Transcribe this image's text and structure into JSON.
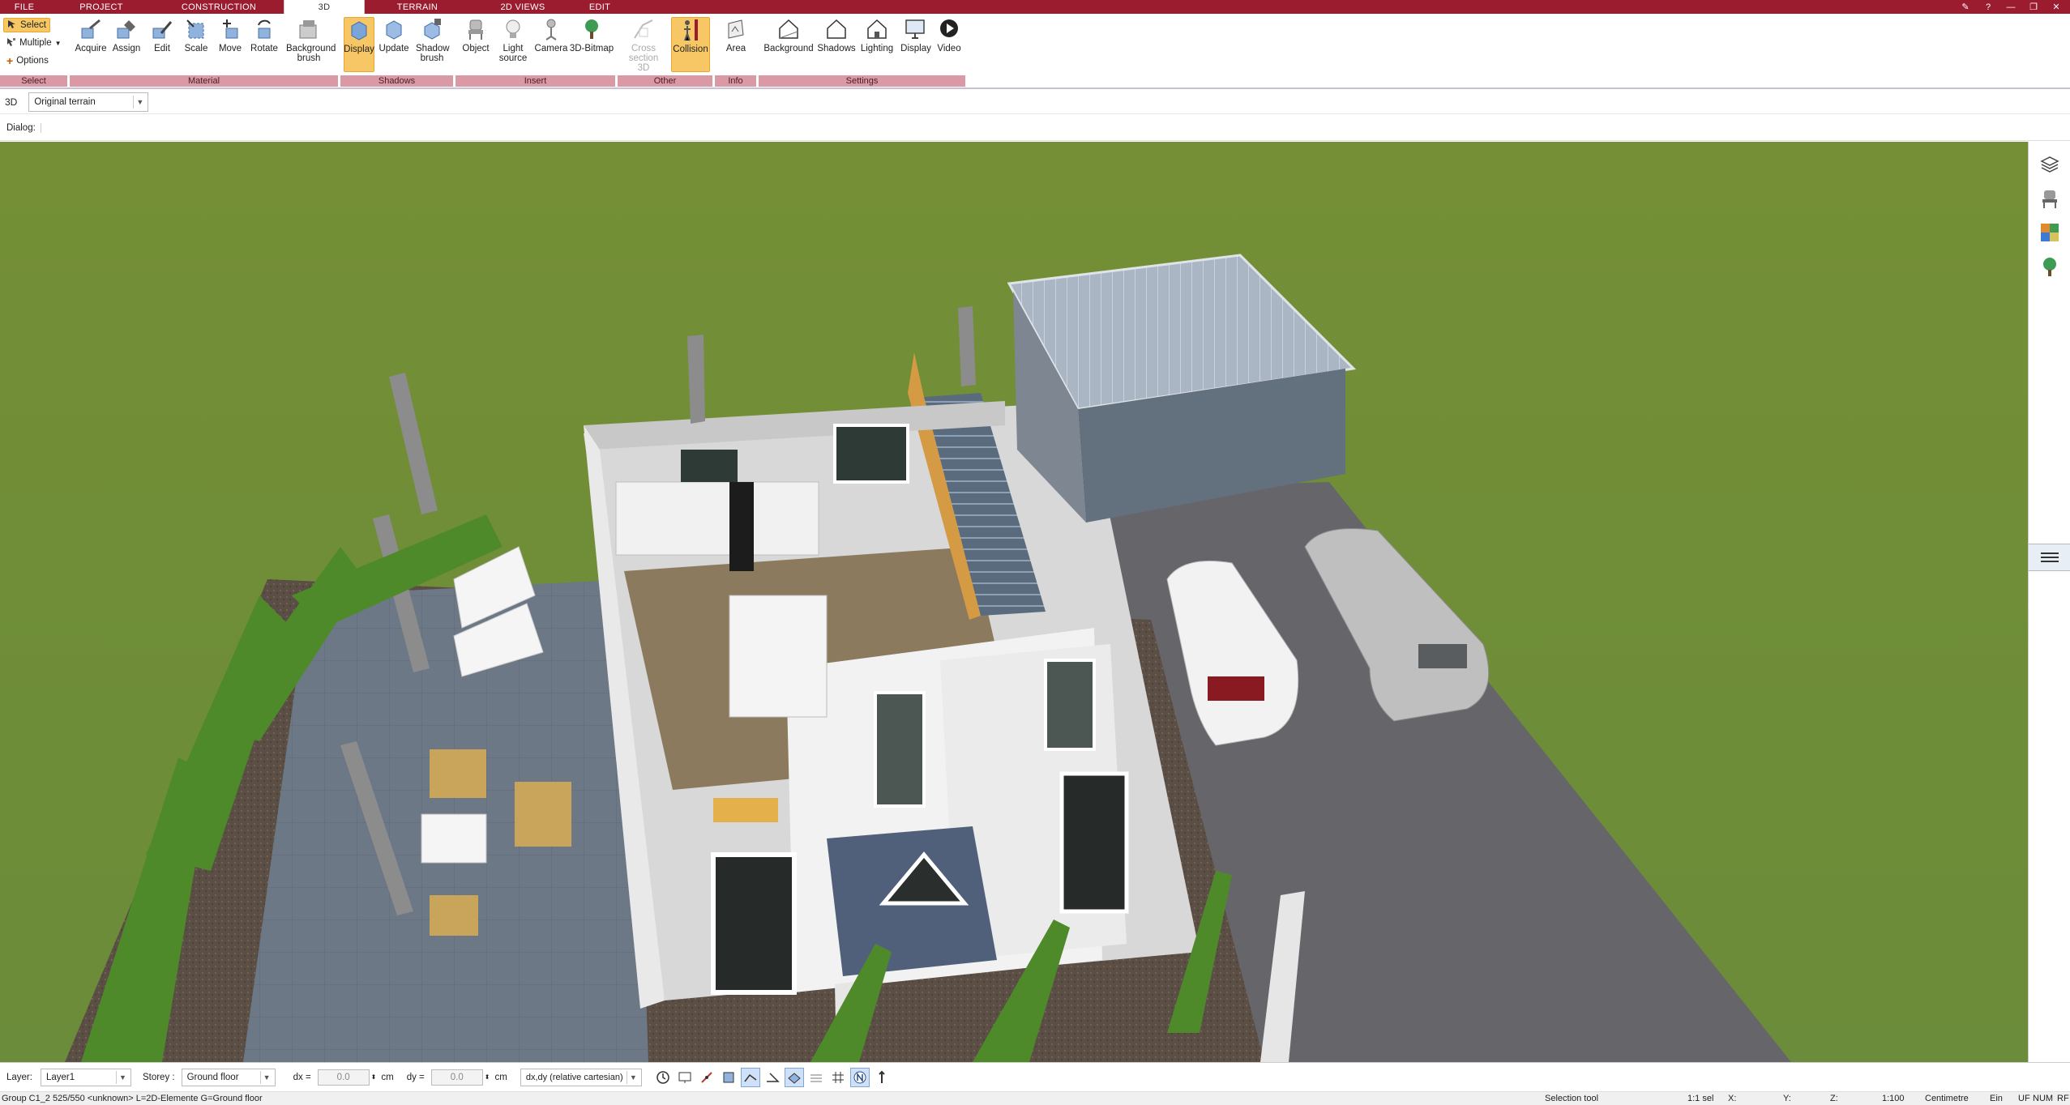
{
  "menubar": {
    "tabs": [
      "FILE",
      "PROJECT",
      "CONSTRUCTION",
      "3D",
      "TERRAIN",
      "2D VIEWS",
      "EDIT"
    ],
    "active_tab": "3D"
  },
  "ribbon": {
    "select_group": {
      "select": "Select",
      "multiple": "Multiple",
      "options": "Options",
      "title": "Select"
    },
    "material": {
      "title": "Material",
      "buttons": [
        "Acquire",
        "Assign",
        "Edit",
        "Scale",
        "Move",
        "Rotate",
        "Background brush"
      ]
    },
    "shadows": {
      "title": "Shadows",
      "buttons": [
        "Display",
        "Update",
        "Shadow brush"
      ]
    },
    "insert": {
      "title": "Insert",
      "buttons": [
        "Object",
        "Light source",
        "Camera",
        "3D-Bitmap"
      ]
    },
    "other": {
      "title": "Other",
      "buttons": [
        "Cross section 3D",
        "Collision"
      ]
    },
    "info": {
      "title": "Info",
      "buttons": [
        "Area"
      ]
    },
    "settings": {
      "title": "Settings",
      "buttons": [
        "Background",
        "Shadows",
        "Lighting",
        "Display",
        "Video"
      ]
    }
  },
  "toolbar": {
    "view_label": "3D",
    "terrain_value": "Original terrain",
    "dialog_label": "Dialog:"
  },
  "bottombar": {
    "layer_label": "Layer:",
    "layer_value": "Layer1",
    "storey_label": "Storey :",
    "storey_value": "Ground floor",
    "dx_label": "dx =",
    "dx_value": "0.0",
    "dx_unit": "cm",
    "dy_label": "dy =",
    "dy_value": "0.0",
    "dy_unit": "cm",
    "coord_mode": "dx,dy (relative cartesian)"
  },
  "statusbar": {
    "info": "Group C1_2 525/550 <unknown> L=2D-Elemente G=Ground floor",
    "tool": "Selection tool",
    "selection": "1:1 sel",
    "x_label": "X:",
    "y_label": "Y:",
    "z_label": "Z:",
    "scale": "1:100",
    "unit": "Centimetre",
    "mode": "Ein",
    "uf": "UF",
    "num": "NUM",
    "rf": "RF"
  }
}
